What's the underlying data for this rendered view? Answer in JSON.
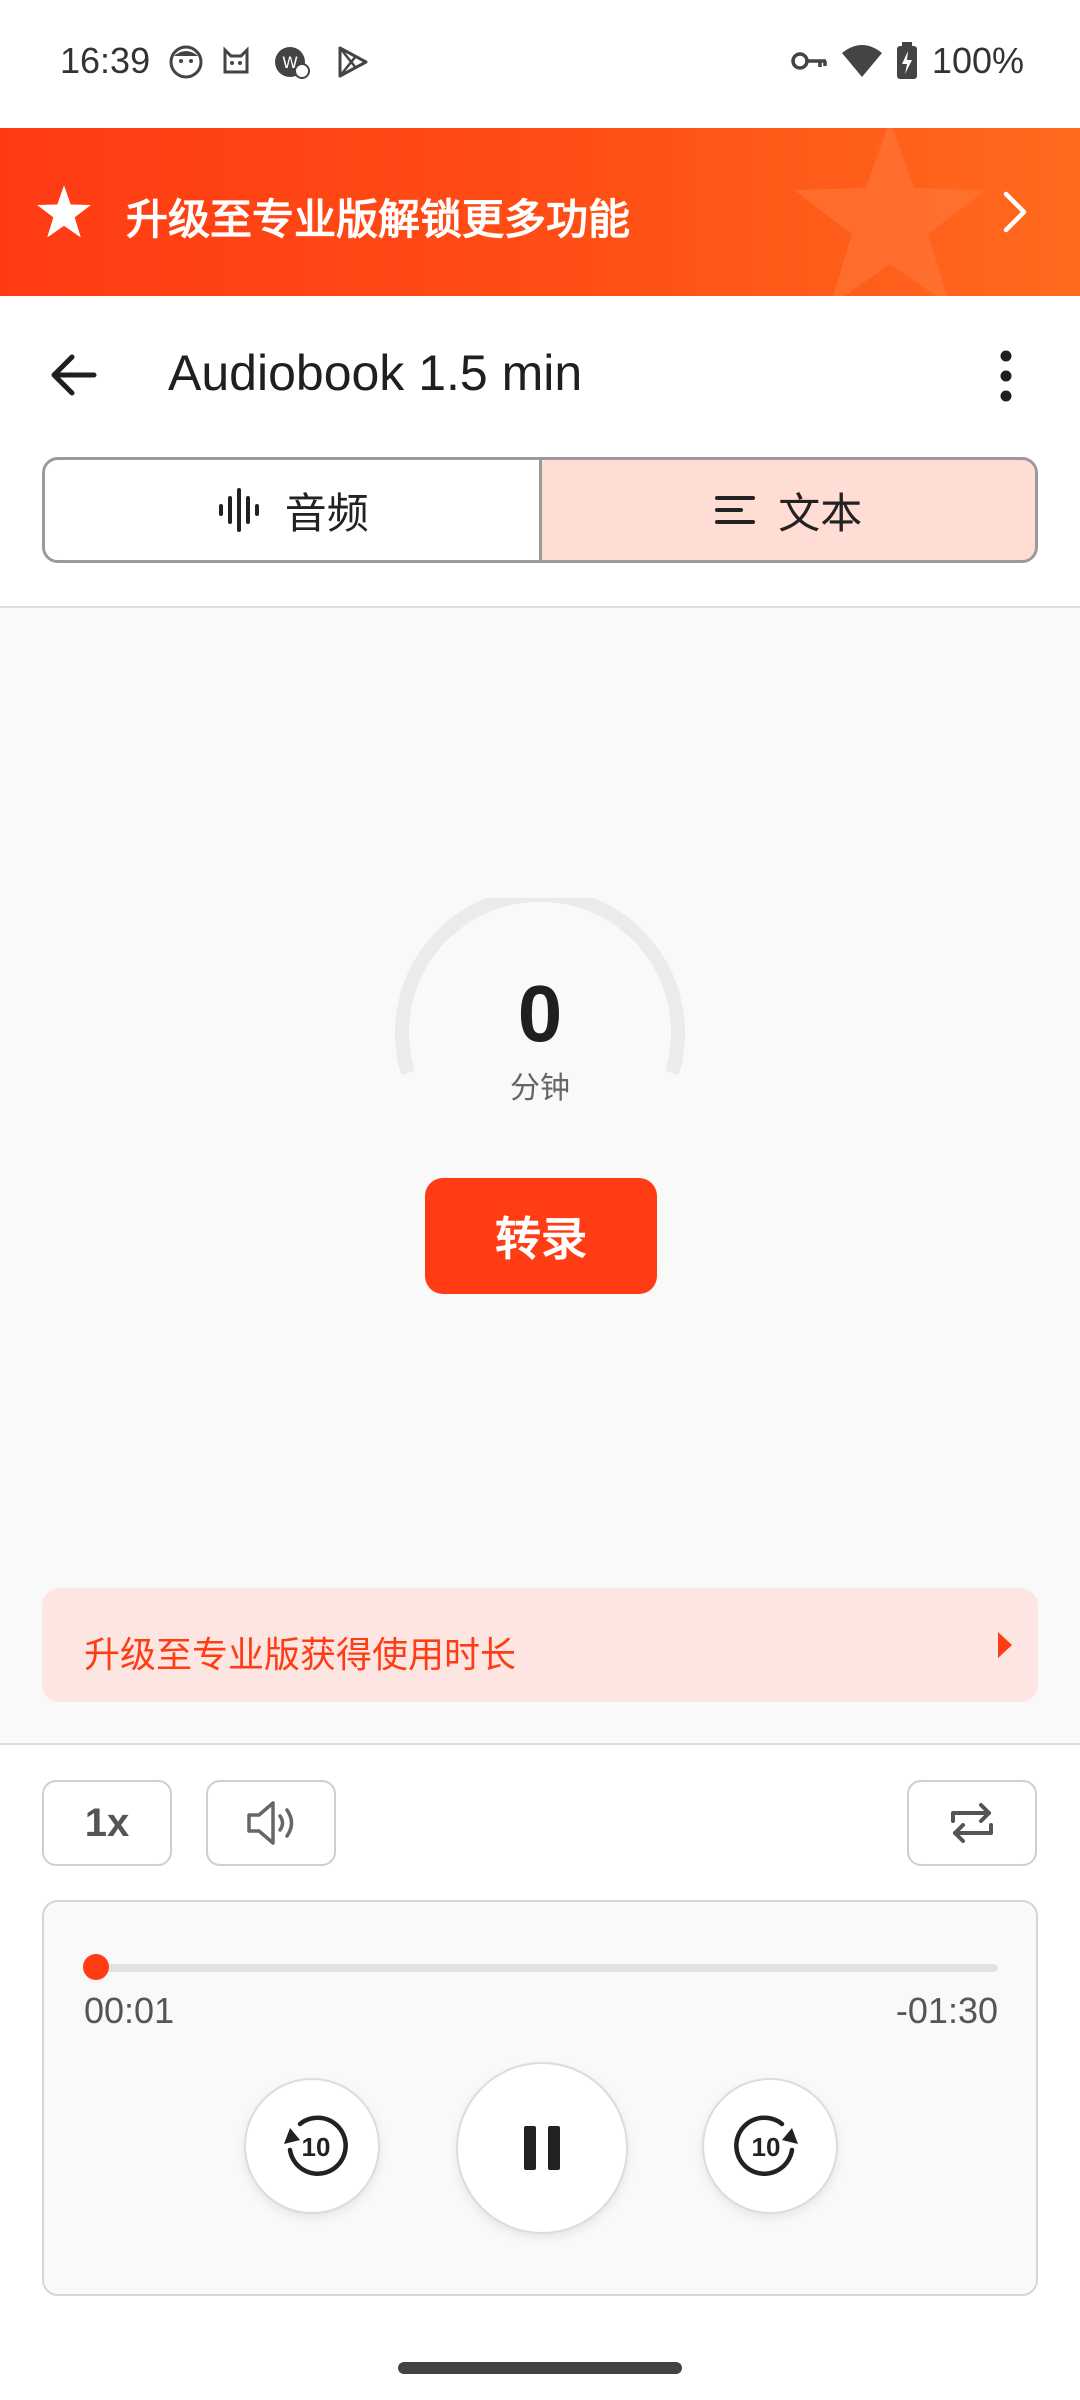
{
  "status_bar": {
    "time": "16:39",
    "battery": "100%",
    "icons": [
      "notification-face-icon",
      "cat-icon",
      "app-badge-icon",
      "play-store-icon",
      "vpn-key-icon",
      "wifi-icon",
      "battery-icon"
    ]
  },
  "promo_banner": {
    "text": "升级至专业版解锁更多功能",
    "icon": "star-icon",
    "arrow_icon": "chevron-right-icon"
  },
  "app_bar": {
    "title": "Audiobook 1.5 min",
    "back_icon": "back-arrow-icon",
    "menu_icon": "more-vert-icon"
  },
  "tabs": [
    {
      "label": "音频",
      "icon": "waveform-icon",
      "selected": false
    },
    {
      "label": "文本",
      "icon": "lines-icon",
      "selected": true
    }
  ],
  "minutes": {
    "value": "0",
    "unit": "分钟"
  },
  "transcribe_button": "转录",
  "upgrade_card": {
    "text": "升级至专业版获得使用时长",
    "arrow_icon": "triangle-right-icon"
  },
  "player": {
    "speed": "1x",
    "elapsed": "00:01",
    "remaining": "-01:30",
    "progress_fraction": 0.011,
    "rewind_label": "10",
    "forward_label": "10"
  },
  "colors": {
    "accent": "#ff3c14",
    "tab_selected_bg": "#ffdcd4",
    "card_bg": "#fde5e1"
  }
}
